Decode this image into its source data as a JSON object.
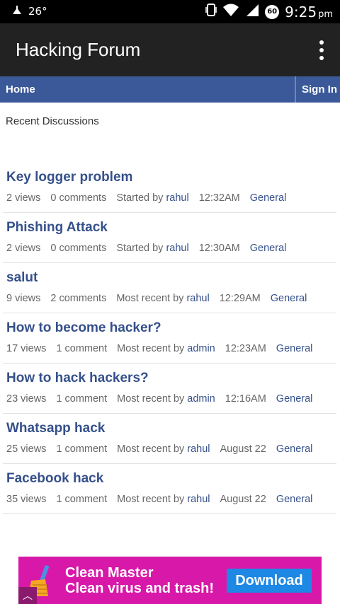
{
  "status_bar": {
    "temperature": "26°",
    "alarm_badge": "60",
    "time": "9:25",
    "time_suffix": "pm"
  },
  "app_bar": {
    "title": "Hacking Forum"
  },
  "nav": {
    "home": "Home",
    "sign_in": "Sign In"
  },
  "section": {
    "title": "Recent Discussions"
  },
  "discussions": [
    {
      "title": "Key logger problem",
      "views": "2 views",
      "comments": "0 comments",
      "by_label": "Started by",
      "user": "rahul",
      "time": "12:32AM",
      "category": "General"
    },
    {
      "title": "Phishing Attack",
      "views": "2 views",
      "comments": "0 comments",
      "by_label": "Started by",
      "user": "rahul",
      "time": "12:30AM",
      "category": "General"
    },
    {
      "title": "salut",
      "views": "9 views",
      "comments": "2 comments",
      "by_label": "Most recent by",
      "user": "rahul",
      "time": "12:29AM",
      "category": "General"
    },
    {
      "title": "How to become hacker?",
      "views": "17 views",
      "comments": "1 comment",
      "by_label": "Most recent by",
      "user": "admin",
      "time": "12:23AM",
      "category": "General"
    },
    {
      "title": "How to hack hackers?",
      "views": "23 views",
      "comments": "1 comment",
      "by_label": "Most recent by",
      "user": "admin",
      "time": "12:16AM",
      "category": "General"
    },
    {
      "title": "Whatsapp hack",
      "views": "25 views",
      "comments": "1 comment",
      "by_label": "Most recent by",
      "user": "rahul",
      "time": "August 22",
      "category": "General"
    },
    {
      "title": "Facebook hack",
      "views": "35 views",
      "comments": "1 comment",
      "by_label": "Most recent by",
      "user": "rahul",
      "time": "August 22",
      "category": "General"
    }
  ],
  "ad": {
    "line1": "Clean Master",
    "line2": "Clean virus and trash!",
    "button": "Download",
    "icon": "broom-icon"
  },
  "colors": {
    "nav_blue": "#3b5998",
    "link_blue": "#35508b",
    "app_bar": "#222222",
    "ad_bg": "#d818a8",
    "ad_button": "#1e88e5"
  }
}
